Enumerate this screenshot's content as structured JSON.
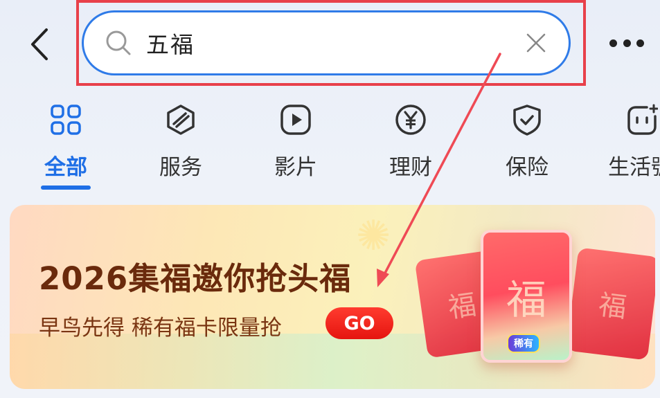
{
  "header": {
    "search": {
      "query": "五福"
    }
  },
  "tabs": [
    {
      "label": "全部",
      "icon": "grid-four-icon",
      "active": true
    },
    {
      "label": "服务",
      "icon": "service-cube-icon",
      "active": false
    },
    {
      "label": "影片",
      "icon": "play-icon",
      "active": false
    },
    {
      "label": "理财",
      "icon": "yen-icon",
      "active": false
    },
    {
      "label": "保险",
      "icon": "shield-check-icon",
      "active": false
    },
    {
      "label": "生活號",
      "icon": "face-plus-icon",
      "active": false
    }
  ],
  "banner": {
    "title": "2026集福邀你抢头福",
    "subtitle": "早鸟先得 稀有福卡限量抢",
    "go_label": "GO",
    "card_char": "福",
    "card_badge": "稀有"
  },
  "colors": {
    "accent": "#1f6fe6",
    "annotation": "#e8404a",
    "go_button": "#e5150f",
    "banner_title": "#6a2a0c"
  }
}
